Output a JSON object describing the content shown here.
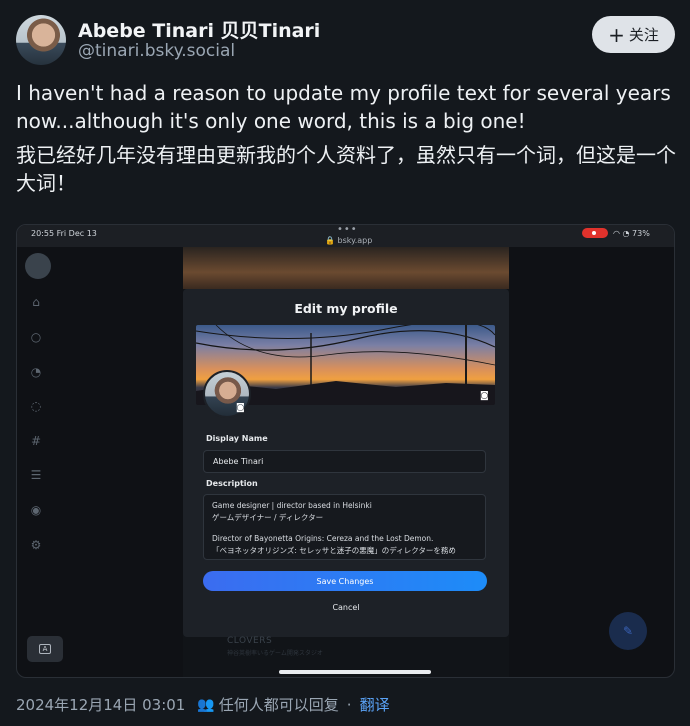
{
  "post": {
    "author_name": "Abebe Tinari 贝贝Tinari",
    "handle": "@tinari.bsky.social",
    "follow_label": "关注",
    "text_en": "I haven't had a reason to update my profile text for several years now...although it's only one word, this is a big one!",
    "text_zh": "我已经好几年没有理由更新我的个人资料了，虽然只有一个词，但这是一个大词！",
    "timestamp": "2024年12月14日 03:01",
    "reply_setting": "任何人都可以回复",
    "separator": "·",
    "translate_label": "翻译"
  },
  "screenshot": {
    "status_time": "20:55  Fri Dec 13",
    "status_dots": "•••",
    "status_url": "🔒 bsky.app",
    "status_battery": "73%",
    "modal_title": "Edit my profile",
    "display_name_label": "Display Name",
    "display_name_value": "Abebe Tinari",
    "description_label": "Description",
    "description_lines": [
      "Game designer | director based in Helsinki",
      "ゲームデザイナー / ディレクター",
      "",
      "Director of Bayonetta Origins: Cereza and the Lost Demon.",
      "「ベヨネッタオリジンズ: セレッサと迷子の悪魔」のディレクターを務め"
    ],
    "save_label": "Save Changes",
    "cancel_label": "Cancel",
    "background_brand": "CLOVERS",
    "background_sub": "神谷英樹率いるゲーム開発スタジオ",
    "keyboard_label": "A"
  }
}
